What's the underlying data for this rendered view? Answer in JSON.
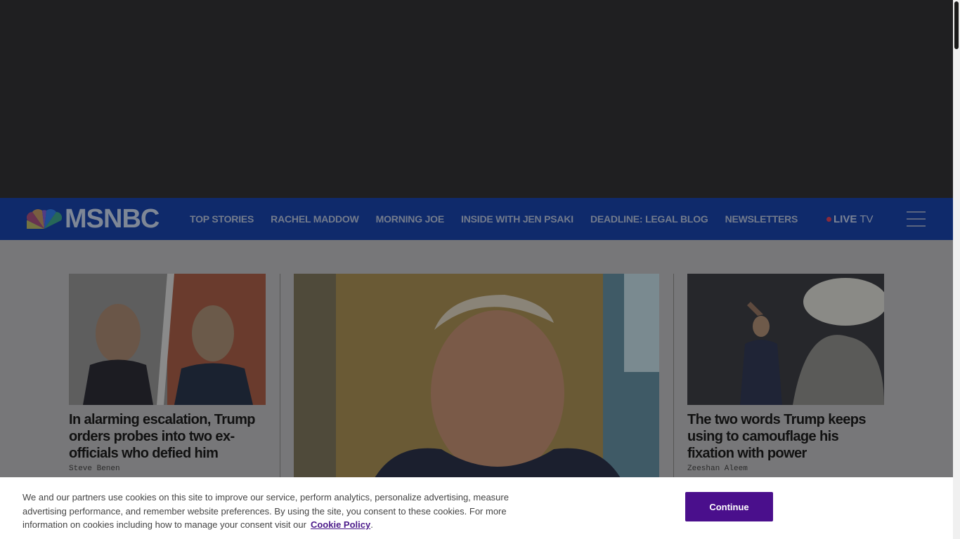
{
  "brand": {
    "name": "MSNBC",
    "colors": {
      "nav_bg": "#0f2a6b",
      "cookie_button": "#4a0f8c",
      "cookie_link": "#4b1a8a"
    }
  },
  "nav": {
    "links": [
      "TOP STORIES",
      "RACHEL MADDOW",
      "MORNING JOE",
      "INSIDE WITH JEN PSAKI",
      "DEADLINE: LEGAL BLOG",
      "NEWSLETTERS"
    ],
    "live_strong": "LIVE",
    "live_light": "TV",
    "menu_icon": "hamburger-icon"
  },
  "stories": {
    "left": {
      "headline": "In alarming escalation, Trump orders probes into two ex-officials who defied him",
      "byline": "Steve Benen"
    },
    "right": {
      "headline": "The two words Trump keeps using to camouflage his fixation with power",
      "byline": "Zeeshan Aleem"
    }
  },
  "cookie_banner": {
    "text": "We and our partners use cookies on this site to improve our service, perform analytics, personalize advertising, measure advertising performance, and remember website preferences. By using the site, you consent to these cookies. For more information on cookies including how to manage your consent visit our",
    "link": "Cookie Policy",
    "button": "Continue"
  }
}
